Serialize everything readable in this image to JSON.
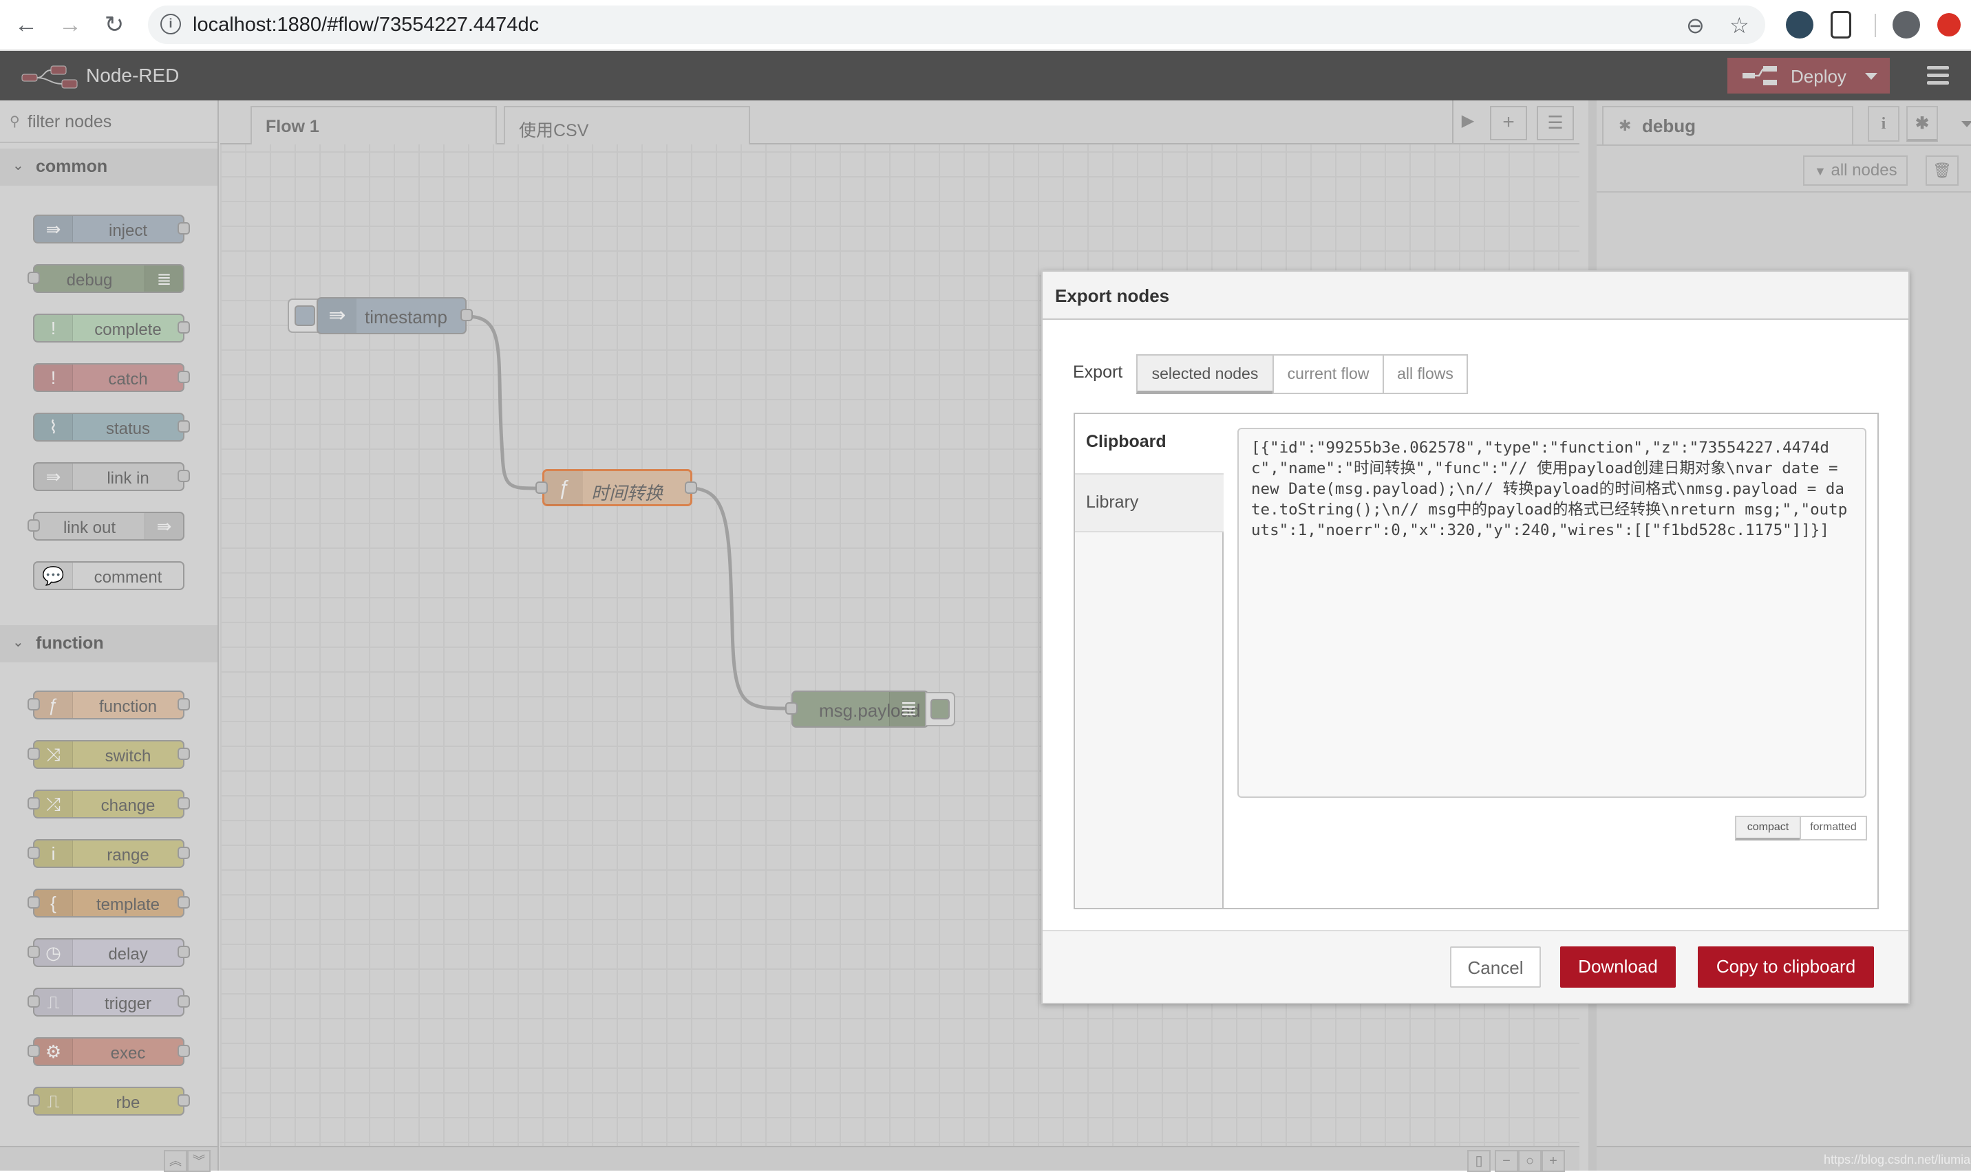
{
  "browser": {
    "url": "localhost:1880/#flow/73554227.4474dc",
    "back_icon": "←",
    "forward_icon": "→",
    "reload_icon": "↻",
    "info_icon": "i",
    "zoom_icon": "⊖",
    "star_icon": "☆"
  },
  "app": {
    "title": "Node-RED",
    "deploy_label": "Deploy",
    "menu_icon": "hamburger-menu-icon"
  },
  "palette": {
    "filter_placeholder": "filter nodes",
    "search_icon": "⚲",
    "categories": [
      {
        "label": "common",
        "nodes": [
          {
            "label": "inject",
            "icon": "⇛",
            "color": "#a3adb7"
          },
          {
            "label": "debug",
            "icon": "≣",
            "color": "#94a18d"
          },
          {
            "label": "complete",
            "icon": "!",
            "color": "#b0c8b0"
          },
          {
            "label": "catch",
            "icon": "!",
            "color": "#c09494"
          },
          {
            "label": "status",
            "icon": "⌇",
            "color": "#9bafb5"
          },
          {
            "label": "link in",
            "icon": "⇛",
            "color": "#c3c3c3"
          },
          {
            "label": "link out",
            "icon": "⇛",
            "color": "#c3c3c3"
          },
          {
            "label": "comment",
            "icon": "💬",
            "color": "#cfcfcf"
          }
        ]
      },
      {
        "label": "function",
        "nodes": [
          {
            "label": "function",
            "icon": "ƒ",
            "color": "#d2b8a1"
          },
          {
            "label": "switch",
            "icon": "⤨",
            "color": "#c2bd8b"
          },
          {
            "label": "change",
            "icon": "⤮",
            "color": "#c2bd8b"
          },
          {
            "label": "range",
            "icon": "i",
            "color": "#c2bd8b"
          },
          {
            "label": "template",
            "icon": "{",
            "color": "#caab87"
          },
          {
            "label": "delay",
            "icon": "◷",
            "color": "#c3c1cb"
          },
          {
            "label": "trigger",
            "icon": "⎍",
            "color": "#c3c1cb"
          },
          {
            "label": "exec",
            "icon": "⚙",
            "color": "#c4978d"
          },
          {
            "label": "rbe",
            "icon": "⎍",
            "color": "#c2bd8b"
          }
        ]
      }
    ],
    "collapse_chevron": "⌄",
    "scroll_up": "︽",
    "scroll_down": "︾"
  },
  "workspace": {
    "tabs": [
      {
        "label": "Flow 1",
        "active": true
      },
      {
        "label": "使用CSV",
        "active": false
      }
    ],
    "scroll_right_icon": "▶",
    "add_tab_icon": "+",
    "list_tabs_icon": "☰",
    "flow_nodes": [
      {
        "label": "timestamp",
        "type": "inject",
        "icon": "⇛",
        "color": "#a3adb7"
      },
      {
        "label": "时间转换",
        "type": "function",
        "icon": "ƒ",
        "color": "#d2b8a1"
      },
      {
        "label": "msg.payload",
        "type": "debug",
        "icon": "≣",
        "color": "#94a18d"
      }
    ],
    "footer": {
      "map_icon": "🗺",
      "zoom_out": "−",
      "zoom_reset": "○",
      "zoom_in": "+"
    }
  },
  "sidebar": {
    "active_tab": "debug",
    "tab_icon": "✱",
    "info_icon": "i",
    "debug_icon": "✱",
    "filter_label": "all nodes",
    "filter_icon": "▼",
    "trash_icon": "🗑",
    "watermark": "https://blog.csdn.net/liumiaocn"
  },
  "dialog": {
    "title": "Export nodes",
    "export_label": "Export",
    "export_options": [
      {
        "label": "selected nodes",
        "selected": true
      },
      {
        "label": "current flow",
        "selected": false
      },
      {
        "label": "all flows",
        "selected": false
      }
    ],
    "targets": [
      {
        "label": "Clipboard",
        "active": true
      },
      {
        "label": "Library",
        "active": false
      }
    ],
    "clipboard_text": "[{\"id\":\"99255b3e.062578\",\"type\":\"function\",\"z\":\"73554227.4474dc\",\"name\":\"时间转换\",\"func\":\"// 使用payload创建日期对象\\nvar date = new Date(msg.payload);\\n// 转换payload的时间格式\\nmsg.payload = date.toString();\\n// msg中的payload的格式已经转换\\nreturn msg;\",\"outputs\":1,\"noerr\":0,\"x\":320,\"y\":240,\"wires\":[[\"f1bd528c.1175\"]]}]",
    "format_options": [
      {
        "label": "compact",
        "selected": true
      },
      {
        "label": "formatted",
        "selected": false
      }
    ],
    "buttons": {
      "cancel": "Cancel",
      "download": "Download",
      "copy": "Copy to clipboard"
    }
  }
}
